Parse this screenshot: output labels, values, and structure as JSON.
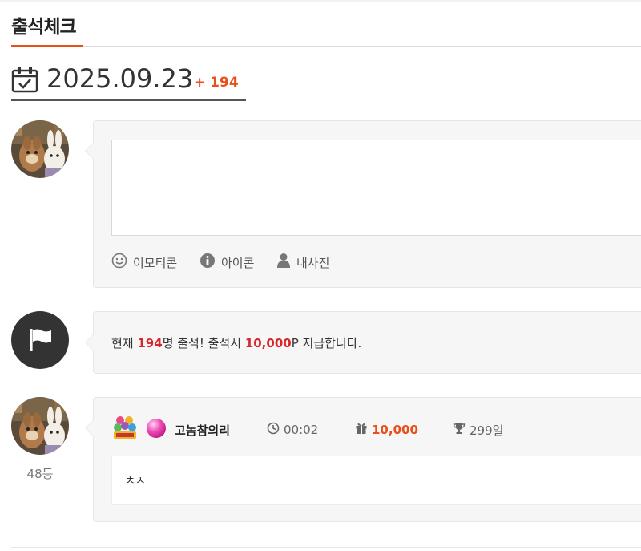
{
  "header": {
    "title": "출석체크"
  },
  "date": {
    "value": "2025.09.23",
    "count": "+ 194",
    "icon": "calendar-check-icon"
  },
  "composer": {
    "tools": [
      {
        "label": "이모티콘",
        "icon": "smile-icon"
      },
      {
        "label": "아이콘",
        "icon": "info-icon"
      },
      {
        "label": "내사진",
        "icon": "person-icon"
      }
    ]
  },
  "notice": {
    "prefix": "현재 ",
    "count": "194",
    "middle": "명 출석! 출석시 ",
    "points": "10,000",
    "suffix": "P 지급합니다.",
    "icon": "flag-icon"
  },
  "entry": {
    "rank": "48등",
    "nickname": "고놈참의리",
    "time": "00:02",
    "points": "10,000",
    "days": "299일",
    "comment": "ㅊㅅ",
    "icons": {
      "time": "clock-icon",
      "points": "gift-icon",
      "days": "trophy-icon",
      "level": "level-badge-icon",
      "grade": "pink-ball-icon"
    }
  },
  "colors": {
    "accent": "#e8501a",
    "highlight": "#d7262c",
    "card": "#f6f6f6"
  }
}
